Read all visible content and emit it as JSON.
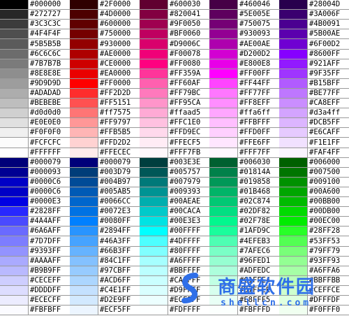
{
  "chart_data": {
    "type": "table",
    "title": "",
    "columns": [
      {
        "name": "column-1",
        "cells": [
          {
            "color": "#000000",
            "label": "#000000"
          },
          {
            "color": "#272727",
            "label": "#272727"
          },
          {
            "color": "#3C3C3C",
            "label": "#3C3C3C"
          },
          {
            "color": "#4F4F4F",
            "label": "#4F4F4F"
          },
          {
            "color": "#5B5B5B",
            "label": "#5B5B5B"
          },
          {
            "color": "#6C6C6C",
            "label": "#6C6C6C"
          },
          {
            "color": "#7B7B7B",
            "label": "#7B7B7B"
          },
          {
            "color": "#8E8E8E",
            "label": "#8E8E8E"
          },
          {
            "color": "#9D9D9D",
            "label": "#9D9D9D"
          },
          {
            "color": "#ADADAD",
            "label": "#ADADAD"
          },
          {
            "color": "#BEBEBE",
            "label": "#BEBEBE"
          },
          {
            "color": "#d0d0d0",
            "label": "#d0d0d0"
          },
          {
            "color": "#E0E0E0",
            "label": "#E0E0E0"
          },
          {
            "color": "#F0F0F0",
            "label": "#F0F0F0"
          },
          {
            "color": "#FCFCFC",
            "label": "#FCFCFC"
          },
          {
            "color": "#FFFFFF",
            "label": "#FFFFFF"
          },
          {
            "color": "#000079",
            "label": "#000079"
          },
          {
            "color": "#000093",
            "label": "#000093"
          },
          {
            "color": "#0000C6",
            "label": "#0000C6"
          },
          {
            "color": "#0000C6",
            "label": "#0000C6"
          },
          {
            "color": "#0000E3",
            "label": "#0000E3"
          },
          {
            "color": "#2828FF",
            "label": "#2828FF"
          },
          {
            "color": "#4A4AFF",
            "label": "#4A4AFF"
          },
          {
            "color": "#6A6AFF",
            "label": "#6A6AFF"
          },
          {
            "color": "#7D7DFF",
            "label": "#7D7DFF"
          },
          {
            "color": "#9393FF",
            "label": "#9393FF"
          },
          {
            "color": "#AAAAFF",
            "label": "#AAAAFF"
          },
          {
            "color": "#B9B9FF",
            "label": "#B9B9FF"
          },
          {
            "color": "#CECEFF",
            "label": "#CECEFF"
          },
          {
            "color": "#DDDDFF",
            "label": "#DDDDFF"
          },
          {
            "color": "#ECECFF",
            "label": "#ECECFF"
          },
          {
            "color": "#FBFBFF",
            "label": "#FBFBFF"
          }
        ]
      },
      {
        "name": "column-2",
        "cells": [
          {
            "color": "#2F0000",
            "label": "#2F0000"
          },
          {
            "color": "#4D0000",
            "label": "#4D0000"
          },
          {
            "color": "#600000",
            "label": "#600000"
          },
          {
            "color": "#750000",
            "label": "#750000"
          },
          {
            "color": "#930000",
            "label": "#930000"
          },
          {
            "color": "#AE0000",
            "label": "#AE0000"
          },
          {
            "color": "#CE0000",
            "label": "#CE0000"
          },
          {
            "color": "#EA0000",
            "label": "#EA0000"
          },
          {
            "color": "#FF0000",
            "label": "#FF0000"
          },
          {
            "color": "#FF2D2D",
            "label": "#FF2D2D"
          },
          {
            "color": "#FF5151",
            "label": "#FF5151"
          },
          {
            "color": "#ff7575",
            "label": "#ff7575"
          },
          {
            "color": "#FF9797",
            "label": "#FF9797"
          },
          {
            "color": "#FFB5B5",
            "label": "#FFB5B5"
          },
          {
            "color": "#FFD2D2",
            "label": "#FFD2D2"
          },
          {
            "color": "#FFECEC",
            "label": "#FFECEC"
          },
          {
            "color": "#000079",
            "label": "#000079"
          },
          {
            "color": "#003D79",
            "label": "#003D79"
          },
          {
            "color": "#004B97",
            "label": "#004B97"
          },
          {
            "color": "#005AB5",
            "label": "#005AB5"
          },
          {
            "color": "#0066CC",
            "label": "#0066CC"
          },
          {
            "color": "#0072E3",
            "label": "#0072E3"
          },
          {
            "color": "#0080FF",
            "label": "#0080FF"
          },
          {
            "color": "#2894FF",
            "label": "#2894FF"
          },
          {
            "color": "#46A3FF",
            "label": "#46A3FF"
          },
          {
            "color": "#66B3FF",
            "label": "#66B3FF"
          },
          {
            "color": "#84C1FF",
            "label": "#84C1FF"
          },
          {
            "color": "#97CBFF",
            "label": "#97CBFF"
          },
          {
            "color": "#ACD6FF",
            "label": "#ACD6FF"
          },
          {
            "color": "#C4E1FF",
            "label": "#C4E1FF"
          },
          {
            "color": "#D2E9FF",
            "label": "#D2E9FF"
          },
          {
            "color": "#ECF5FF",
            "label": "#ECF5FF"
          }
        ]
      },
      {
        "name": "column-3",
        "cells": [
          {
            "color": "#600030",
            "label": "#600030"
          },
          {
            "color": "#820041",
            "label": "#820041"
          },
          {
            "color": "#9F0050",
            "label": "#9F0050"
          },
          {
            "color": "#BF0060",
            "label": "#BF0060"
          },
          {
            "color": "#D9006C",
            "label": "#D9006C"
          },
          {
            "color": "#F00078",
            "label": "#F00078"
          },
          {
            "color": "#FF0080",
            "label": "#FF0080"
          },
          {
            "color": "#FF359A",
            "label": "#FF359A"
          },
          {
            "color": "#FF60AF",
            "label": "#FF60AF"
          },
          {
            "color": "#FF79BC",
            "label": "#FF79BC"
          },
          {
            "color": "#FF95CA",
            "label": "#FF95CA"
          },
          {
            "color": "#ffaad5",
            "label": "#ffaad5"
          },
          {
            "color": "#FFC1E0",
            "label": "#FFC1E0"
          },
          {
            "color": "#FFD9EC",
            "label": "#FFD9EC"
          },
          {
            "color": "#FFECF5",
            "label": "#FFECF5"
          },
          {
            "color": "#FFF7FB",
            "label": "#FFF7FB"
          },
          {
            "color": "#003E3E",
            "label": "#003E3E"
          },
          {
            "color": "#005757",
            "label": "#005757"
          },
          {
            "color": "#007979",
            "label": "#007979"
          },
          {
            "color": "#009393",
            "label": "#009393"
          },
          {
            "color": "#00AEAE",
            "label": "#00AEAE"
          },
          {
            "color": "#00CACA",
            "label": "#00CACA"
          },
          {
            "color": "#00E3E3",
            "label": "#00E3E3"
          },
          {
            "color": "#00FFFF",
            "label": "#00FFFF"
          },
          {
            "color": "#4DFFFF",
            "label": "#4DFFFF"
          },
          {
            "color": "#80FFFF",
            "label": "#80FFFF"
          },
          {
            "color": "#A6FFFF",
            "label": "#A6FFFF"
          },
          {
            "color": "#BBFFFF",
            "label": "#BBFFFF"
          },
          {
            "color": "#CAFFFF",
            "label": "#CAFFFF"
          },
          {
            "color": "#D9FFFF",
            "label": "#D9FFFF"
          },
          {
            "color": "#ECFFFF",
            "label": "#ECFFFF"
          },
          {
            "color": "#FDFFFF",
            "label": "#FDFFFF"
          }
        ]
      },
      {
        "name": "column-4",
        "cells": [
          {
            "color": "#460046",
            "label": "#460046"
          },
          {
            "color": "#5E005E",
            "label": "#5E005E"
          },
          {
            "color": "#750075",
            "label": "#750075"
          },
          {
            "color": "#930093",
            "label": "#930093"
          },
          {
            "color": "#AE00AE",
            "label": "#AE00AE"
          },
          {
            "color": "#D200D2",
            "label": "#D200D2"
          },
          {
            "color": "#E800E8",
            "label": "#E800E8"
          },
          {
            "color": "#FF00FF",
            "label": "#FF00FF"
          },
          {
            "color": "#FF44FF",
            "label": "#FF44FF"
          },
          {
            "color": "#FF77FF",
            "label": "#FF77FF"
          },
          {
            "color": "#FF8EFF",
            "label": "#FF8EFF"
          },
          {
            "color": "#ffa6ff",
            "label": "#ffa6ff"
          },
          {
            "color": "#FFBFFF",
            "label": "#FFBFFF"
          },
          {
            "color": "#FFD0FF",
            "label": "#FFD0FF"
          },
          {
            "color": "#FFE6FF",
            "label": "#FFE6FF"
          },
          {
            "color": "#FFF7FF",
            "label": "#FFF7FF"
          },
          {
            "color": "#006030",
            "label": "#006030"
          },
          {
            "color": "#01814A",
            "label": "#01814A"
          },
          {
            "color": "#019858",
            "label": "#019858"
          },
          {
            "color": "#01B468",
            "label": "#01B468"
          },
          {
            "color": "#02C874",
            "label": "#02C874"
          },
          {
            "color": "#02DF82",
            "label": "#02DF82"
          },
          {
            "color": "#02F78E",
            "label": "#02F78E"
          },
          {
            "color": "#1AFD9C",
            "label": "#1AFD9C"
          },
          {
            "color": "#4EFEB3",
            "label": "#4EFEB3"
          },
          {
            "color": "#7AFEC6",
            "label": "#7AFEC6"
          },
          {
            "color": "#96FED1",
            "label": "#96FED1"
          },
          {
            "color": "#ADFEDC",
            "label": "#ADFEDC"
          },
          {
            "color": "#C1FFE4",
            "label": "#C1FFE4"
          },
          {
            "color": "#D7FFEE",
            "label": "#D7FFEE"
          },
          {
            "color": "#E8FFF5",
            "label": "#E8FFF5"
          },
          {
            "color": "#FBFFFD",
            "label": "#FBFFFD"
          }
        ]
      },
      {
        "name": "column-5",
        "cells": [
          {
            "color": "#28004D",
            "label": "#28004D"
          },
          {
            "color": "#3A006F",
            "label": "#3A006F"
          },
          {
            "color": "#4B0091",
            "label": "#4B0091"
          },
          {
            "color": "#5B00AE",
            "label": "#5B00AE"
          },
          {
            "color": "#6F00D2",
            "label": "#6F00D2"
          },
          {
            "color": "#8600FF",
            "label": "#8600FF"
          },
          {
            "color": "#921AFF",
            "label": "#921AFF"
          },
          {
            "color": "#9F35FF",
            "label": "#9F35FF"
          },
          {
            "color": "#B15BFF",
            "label": "#B15BFF"
          },
          {
            "color": "#BE77FF",
            "label": "#BE77FF"
          },
          {
            "color": "#CA8EFF",
            "label": "#CA8EFF"
          },
          {
            "color": "#d3a4ff",
            "label": "#d3a4ff"
          },
          {
            "color": "#DCB5FF",
            "label": "#DCB5FF"
          },
          {
            "color": "#E6CAFF",
            "label": "#E6CAFF"
          },
          {
            "color": "#F1E1FF",
            "label": "#F1E1FF"
          },
          {
            "color": "#FAF4FF",
            "label": "#FAF4FF"
          },
          {
            "color": "#006000",
            "label": "#006000"
          },
          {
            "color": "#007500",
            "label": "#007500"
          },
          {
            "color": "#009100",
            "label": "#009100"
          },
          {
            "color": "#00A600",
            "label": "#00A600"
          },
          {
            "color": "#00BB00",
            "label": "#00BB00"
          },
          {
            "color": "#00DB00",
            "label": "#00DB00"
          },
          {
            "color": "#00EC00",
            "label": "#00EC00"
          },
          {
            "color": "#28FF28",
            "label": "#28FF28"
          },
          {
            "color": "#53FF53",
            "label": "#53FF53"
          },
          {
            "color": "#79FF79",
            "label": "#79FF79"
          },
          {
            "color": "#93FF93",
            "label": "#93FF93"
          },
          {
            "color": "#A6FFA6",
            "label": "#A6FFA6"
          },
          {
            "color": "#BBFFBB",
            "label": "#BBFFBB"
          },
          {
            "color": "#CEFFCE",
            "label": "#CEFFCE"
          },
          {
            "color": "#DFFFDF",
            "label": "#DFFFDF"
          },
          {
            "color": "#F0FFF0",
            "label": "#F0FFF0"
          }
        ]
      }
    ]
  },
  "watermark": {
    "brand": "商盛软件园",
    "url": "shellcn.com",
    "color": "#2f6fe8"
  }
}
